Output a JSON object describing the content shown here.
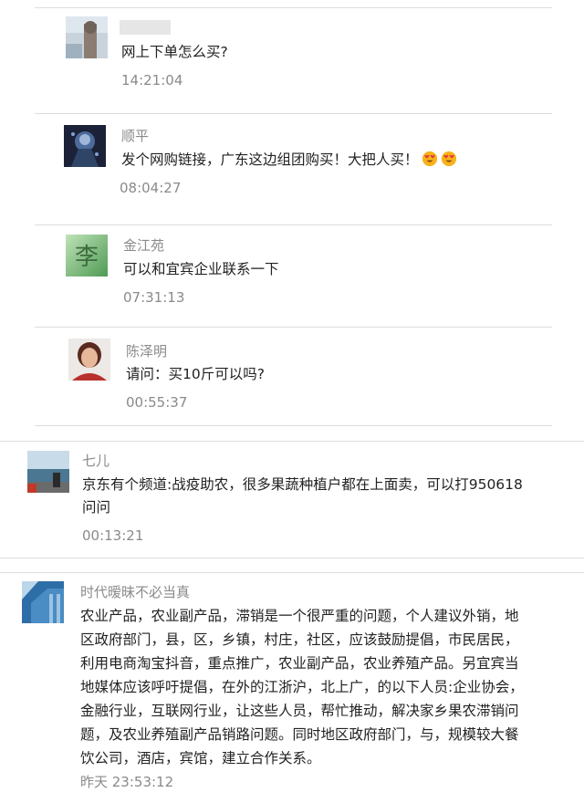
{
  "comments": [
    {
      "name": "",
      "text": "网上下单怎么买?",
      "time": "14:21:04",
      "avatar_icon": "person-photo-avatar-icon"
    },
    {
      "name": "顺平",
      "text": "发个网购链接，广东这边组团购买！大把人买！",
      "emojis": [
        "heart-eyes-emoji",
        "heart-eyes-emoji"
      ],
      "time": "08:04:27",
      "avatar_icon": "fantasy-portrait-avatar-icon"
    },
    {
      "name": "金江苑",
      "text": "可以和宜宾企业联系一下",
      "time": "07:31:13",
      "avatar_icon": "li-character-avatar-icon",
      "avatar_char": "李"
    },
    {
      "name": "陈泽明",
      "text": "请问：买10斤可以吗?",
      "time": "00:55:37",
      "avatar_icon": "woman-portrait-avatar-icon"
    },
    {
      "name": "七儿",
      "text_lines": [
        "京东有个频道:战疫助农，很多果蔬种植户都在上面卖，可以打950618",
        "问问"
      ],
      "time": "00:13:21",
      "avatar_icon": "seaside-photo-avatar-icon"
    },
    {
      "name": "时代暧昧不必当真",
      "text_lines": [
        "农业产品，农业副产品，滞销是一个很严重的问题，个人建议外销，地",
        "区政府部门，县，区，乡镇，村庄，社区，应该鼓励提倡，市民居民，",
        "利用电商淘宝抖音，重点推广，农业副产品，农业养殖产品。另宜宾当",
        "地媒体应该呼吁提倡，在外的江浙沪，北上广，的以下人员:企业协会，",
        "金融行业，互联网行业，让这些人员，帮忙推动，解决家乡果农滞销问",
        "题，及农业养殖副产品销路问题。同时地区政府部门，与，规模较大餐",
        "饮公司，酒店，宾馆，建立合作关系。"
      ],
      "time": "昨天 23:53:12",
      "avatar_icon": "blue-building-avatar-icon"
    }
  ],
  "colors": {
    "name": "#8a8a8a",
    "text": "#222222",
    "time": "#8a8a8a",
    "separator": "#dcdcdc"
  }
}
